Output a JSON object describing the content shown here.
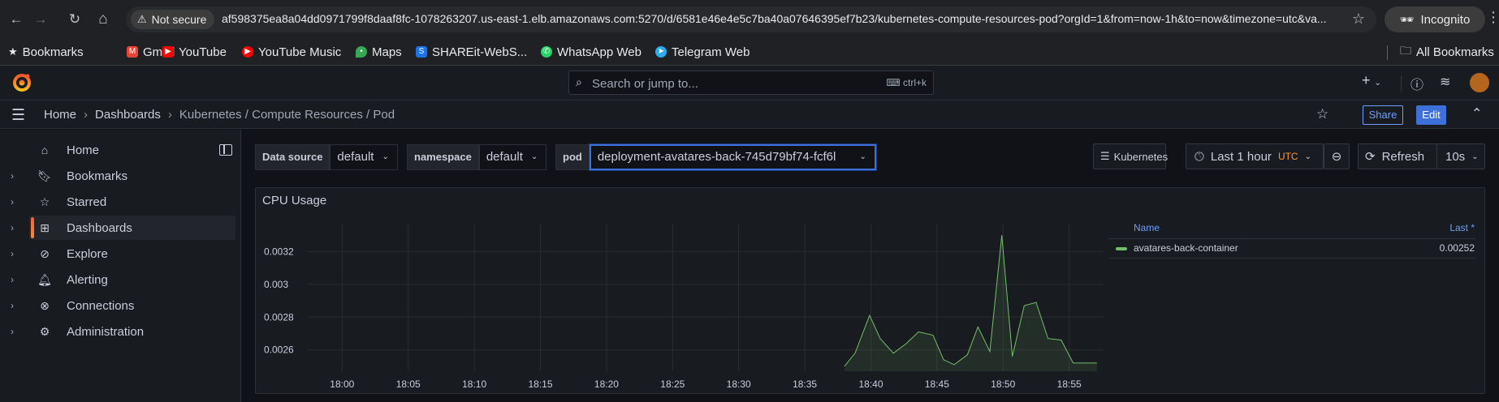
{
  "browser": {
    "back": "←",
    "forward": "→",
    "reload": "↻",
    "home": "⌂",
    "not_secure": "Not secure",
    "url": "af598375ea8a04dd0971799f8daaf8fc-1078263207.us-east-1.elb.amazonaws.com:5270/d/6581e46e4e5c7ba40a07646395ef7b23/kubernetes-compute-resources-pod?orgId=1&from=now-1h&to=now&timezone=utc&va...",
    "incognito": "Incognito"
  },
  "bookmarks": {
    "items": [
      {
        "label": "Bookmarks",
        "icon": "star-icon"
      },
      {
        "label": "Gmail",
        "icon": "gmail-icon"
      },
      {
        "label": "YouTube",
        "icon": "youtube-icon"
      },
      {
        "label": "YouTube Music",
        "icon": "youtube-music-icon"
      },
      {
        "label": "Maps",
        "icon": "maps-icon"
      },
      {
        "label": "SHAREit-WebS...",
        "icon": "shareit-icon"
      },
      {
        "label": "WhatsApp Web",
        "icon": "whatsapp-icon"
      },
      {
        "label": "Telegram Web",
        "icon": "telegram-icon"
      }
    ],
    "all_bookmarks": "All Bookmarks"
  },
  "grafana": {
    "search_placeholder": "Search or jump to...",
    "search_shortcut": "ctrl+k",
    "breadcrumbs": [
      "Home",
      "Dashboards",
      "Kubernetes / Compute Resources / Pod"
    ],
    "share_label": "Share",
    "edit_label": "Edit"
  },
  "sidebar": {
    "items": [
      {
        "label": "Home",
        "icon": "home-icon",
        "expandable": false,
        "active": false
      },
      {
        "label": "Bookmarks",
        "icon": "bookmark-icon",
        "expandable": true,
        "active": false
      },
      {
        "label": "Starred",
        "icon": "star-icon",
        "expandable": true,
        "active": false
      },
      {
        "label": "Dashboards",
        "icon": "dashboards-icon",
        "expandable": true,
        "active": true
      },
      {
        "label": "Explore",
        "icon": "compass-icon",
        "expandable": true,
        "active": false
      },
      {
        "label": "Alerting",
        "icon": "bell-icon",
        "expandable": true,
        "active": false
      },
      {
        "label": "Connections",
        "icon": "connections-icon",
        "expandable": true,
        "active": false
      },
      {
        "label": "Administration",
        "icon": "gear-icon",
        "expandable": true,
        "active": false
      }
    ]
  },
  "variables": {
    "datasource": {
      "label": "Data source",
      "value": "default"
    },
    "namespace": {
      "label": "namespace",
      "value": "default"
    },
    "pod": {
      "label": "pod",
      "value": "deployment-avatares-back-745d79bf74-fcf6l"
    }
  },
  "toolbar": {
    "kubernetes_label": "Kubernetes",
    "time_range": "Last 1 hour",
    "timezone": "UTC",
    "refresh_label": "Refresh",
    "refresh_interval": "10s"
  },
  "panel": {
    "title": "CPU Usage",
    "legend_header_name": "Name",
    "legend_header_last": "Last *",
    "legend_name": "avatares-back-container",
    "legend_last": "0.00252"
  },
  "chart_data": {
    "type": "line",
    "title": "CPU Usage",
    "xlabel": "",
    "ylabel": "",
    "x_ticks": [
      "18:00",
      "18:05",
      "18:10",
      "18:15",
      "18:20",
      "18:25",
      "18:30",
      "18:35",
      "18:40",
      "18:45",
      "18:50",
      "18:55"
    ],
    "y_ticks": [
      0.0026,
      0.0028,
      0.003,
      0.0032
    ],
    "y_tick_labels": [
      "0.0026",
      "0.0028",
      "0.003",
      "0.0032"
    ],
    "xlim_minutes": [
      -2.6,
      57.6
    ],
    "ylim": [
      0.00247,
      0.00337
    ],
    "grid": true,
    "legend_position": "right",
    "series": [
      {
        "name": "avatares-back-container",
        "color": "#73bf69",
        "x_minutes": [
          38.0,
          38.8,
          39.9,
          40.7,
          41.7,
          42.7,
          43.6,
          44.7,
          45.5,
          46.3,
          47.3,
          48.1,
          49.0,
          49.9,
          50.7,
          51.6,
          52.5,
          53.4,
          54.4,
          55.3,
          56.2,
          57.1
        ],
        "values": [
          0.0025,
          0.00258,
          0.00281,
          0.00267,
          0.00258,
          0.00264,
          0.00271,
          0.00269,
          0.00254,
          0.00251,
          0.00257,
          0.00274,
          0.00259,
          0.0033,
          0.00256,
          0.00287,
          0.00289,
          0.00267,
          0.00266,
          0.00252,
          0.00252,
          0.00252
        ]
      }
    ]
  }
}
